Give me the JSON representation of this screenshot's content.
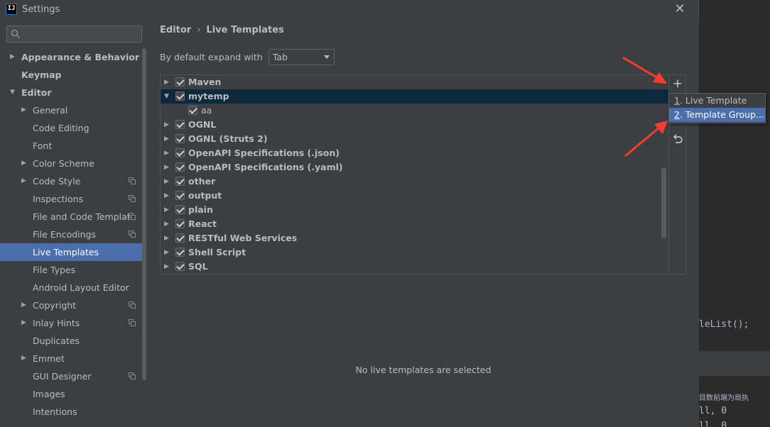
{
  "window": {
    "title": "Settings",
    "app_icon_text": "IJ"
  },
  "search": {
    "placeholder": ""
  },
  "sidebar": {
    "items": [
      {
        "label": "Appearance & Behavior",
        "level": 0,
        "arrow": "right",
        "bold": true
      },
      {
        "label": "Keymap",
        "level": 0,
        "arrow": "",
        "bold": true
      },
      {
        "label": "Editor",
        "level": 0,
        "arrow": "down",
        "bold": true
      },
      {
        "label": "General",
        "level": 1,
        "arrow": "right"
      },
      {
        "label": "Code Editing",
        "level": 1,
        "arrow": ""
      },
      {
        "label": "Font",
        "level": 1,
        "arrow": ""
      },
      {
        "label": "Color Scheme",
        "level": 1,
        "arrow": "right"
      },
      {
        "label": "Code Style",
        "level": 1,
        "arrow": "right",
        "copy": true
      },
      {
        "label": "Inspections",
        "level": 1,
        "arrow": "",
        "copy": true
      },
      {
        "label": "File and Code Templat",
        "level": 1,
        "arrow": "",
        "copy": true
      },
      {
        "label": "File Encodings",
        "level": 1,
        "arrow": "",
        "copy": true
      },
      {
        "label": "Live Templates",
        "level": 1,
        "arrow": "",
        "selected": true
      },
      {
        "label": "File Types",
        "level": 1,
        "arrow": ""
      },
      {
        "label": "Android Layout Editor",
        "level": 1,
        "arrow": ""
      },
      {
        "label": "Copyright",
        "level": 1,
        "arrow": "right",
        "copy": true
      },
      {
        "label": "Inlay Hints",
        "level": 1,
        "arrow": "right",
        "copy": true
      },
      {
        "label": "Duplicates",
        "level": 1,
        "arrow": ""
      },
      {
        "label": "Emmet",
        "level": 1,
        "arrow": "right"
      },
      {
        "label": "GUI Designer",
        "level": 1,
        "arrow": "",
        "copy": true
      },
      {
        "label": "Images",
        "level": 1,
        "arrow": ""
      },
      {
        "label": "Intentions",
        "level": 1,
        "arrow": ""
      }
    ]
  },
  "breadcrumb": {
    "parent": "Editor",
    "separator": "›",
    "current": "Live Templates"
  },
  "expand": {
    "label": "By default expand with",
    "value": "Tab"
  },
  "templates": [
    {
      "name": "Maven",
      "checked": true,
      "expanded": false
    },
    {
      "name": "mytemp",
      "checked": true,
      "expanded": true,
      "selected": true
    },
    {
      "name": "aa",
      "checked": true,
      "child": true
    },
    {
      "name": "OGNL",
      "checked": true,
      "expanded": false
    },
    {
      "name": "OGNL (Struts 2)",
      "checked": true,
      "expanded": false
    },
    {
      "name": "OpenAPI Specifications (.json)",
      "checked": true,
      "expanded": false
    },
    {
      "name": "OpenAPI Specifications (.yaml)",
      "checked": true,
      "expanded": false
    },
    {
      "name": "other",
      "checked": true,
      "expanded": false
    },
    {
      "name": "output",
      "checked": true,
      "expanded": false
    },
    {
      "name": "plain",
      "checked": true,
      "expanded": false
    },
    {
      "name": "React",
      "checked": true,
      "expanded": false
    },
    {
      "name": "RESTful Web Services",
      "checked": true,
      "expanded": false
    },
    {
      "name": "Shell Script",
      "checked": true,
      "expanded": false
    },
    {
      "name": "SQL",
      "checked": true,
      "expanded": false
    }
  ],
  "toolbar": {
    "add_icon": "plus-icon",
    "undo_icon": "undo-icon"
  },
  "popup": {
    "items": [
      {
        "mnemonic": "1",
        "label": ". Live Template"
      },
      {
        "mnemonic": "2",
        "label": ". Template Group...",
        "highlighted": true
      }
    ]
  },
  "empty_message": "No live templates are selected",
  "editor_bg": {
    "code_line": "leList();",
    "console_text": "目数前端为局执",
    "console_line1": "ll, 0",
    "console_line2": "ll, 0"
  },
  "colors": {
    "accent": "#4b6eaf",
    "arrow": "#ff3b30",
    "selected_row": "#0d293e"
  }
}
